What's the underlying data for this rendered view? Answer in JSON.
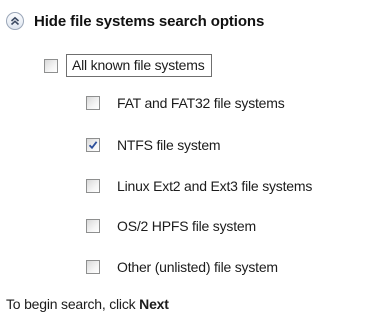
{
  "header": {
    "toggle_icon": "double-chevron-up-icon",
    "title": "Hide file systems search options"
  },
  "all_known": {
    "label": "All known file systems",
    "checked": false
  },
  "file_systems": [
    {
      "label": "FAT and FAT32 file systems",
      "checked": false
    },
    {
      "label": "NTFS file system",
      "checked": true
    },
    {
      "label": "Linux Ext2 and Ext3 file systems",
      "checked": false
    },
    {
      "label": "OS/2 HPFS file system",
      "checked": false
    },
    {
      "label": "Other (unlisted) file system",
      "checked": false
    }
  ],
  "footer": {
    "text": "To begin search, click",
    "action": "Next"
  },
  "colors": {
    "check_mark": "#2d4f9b",
    "toggle_chevrons": "#3c4a63"
  }
}
